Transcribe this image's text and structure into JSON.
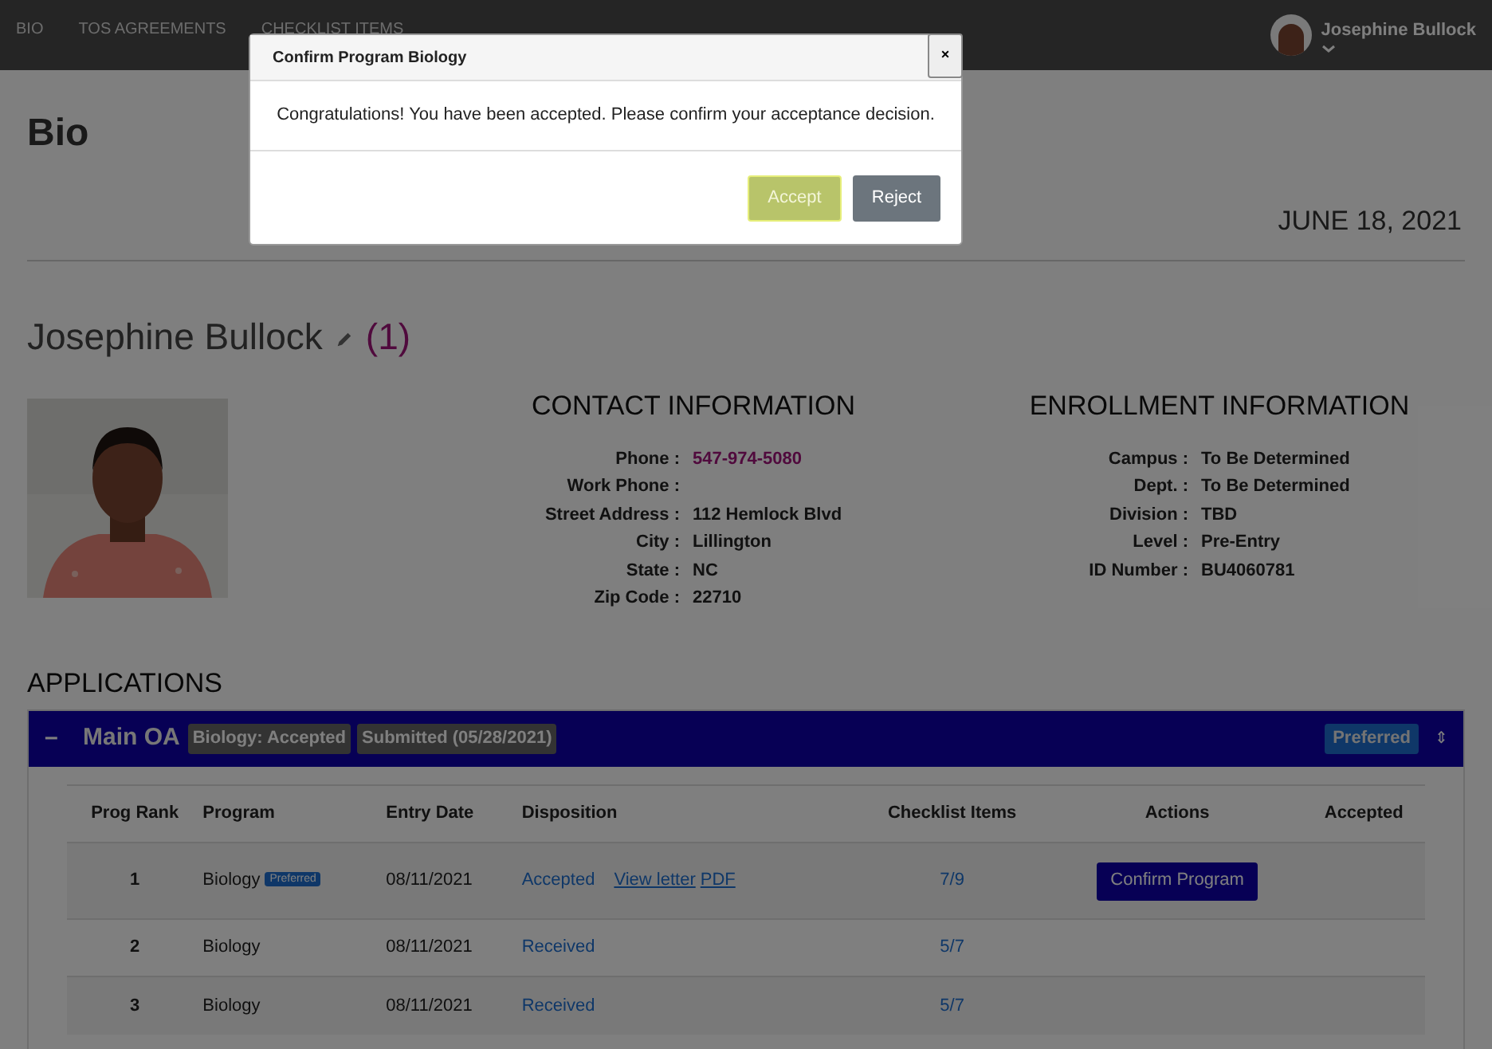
{
  "nav": {
    "items": [
      {
        "label": "BIO"
      },
      {
        "label": "TOS AGREEMENTS"
      },
      {
        "label": "CHECKLIST ITEMS"
      }
    ],
    "user": "Josephine Bullock"
  },
  "page": {
    "title": "Bio",
    "date": "JUNE 18, 2021",
    "name": "Josephine Bullock",
    "count": "(1)"
  },
  "contact": {
    "title": "CONTACT INFORMATION",
    "fields": [
      {
        "label": "Phone :",
        "value": "547-974-5080",
        "kind": "link"
      },
      {
        "label": "Work Phone :"
      },
      {
        "label": "Street Address :",
        "value": "112 Hemlock Blvd",
        "kind": "text"
      },
      {
        "label": "City :",
        "value": "Lillington",
        "kind": "text"
      },
      {
        "label": "State :",
        "value": "NC",
        "kind": "text"
      },
      {
        "label": "Zip Code :",
        "value": "22710",
        "kind": "text"
      }
    ]
  },
  "enrollment": {
    "title": "ENROLLMENT INFORMATION",
    "fields": [
      {
        "label": "Campus :",
        "value": "To Be Determined"
      },
      {
        "label": "Dept. :",
        "value": "To Be Determined"
      },
      {
        "label": "Division :",
        "value": "TBD"
      },
      {
        "label": "Level :",
        "value": "Pre-Entry"
      },
      {
        "label": "ID Number :",
        "value": "BU4060781"
      }
    ]
  },
  "applications": {
    "title": "APPLICATIONS",
    "panel": {
      "toggle": "–",
      "name": "Main OA",
      "badges": [
        "Biology: Accepted",
        "Submitted (05/28/2021)"
      ],
      "preferred": "Preferred",
      "sort": "⇕",
      "expanded": true
    },
    "table": {
      "columns": [
        "Prog Rank",
        "Program",
        "Entry Date",
        "Disposition",
        "Checklist Items",
        "Actions",
        "Accepted"
      ],
      "rows": [
        {
          "rank": "1",
          "program": "Biology",
          "badge": "Preferred",
          "entry": "08/11/2021",
          "disposition": "Accepted",
          "links": [
            "View letter",
            "PDF"
          ],
          "checklist": "7/9",
          "action": "Confirm Program"
        },
        {
          "rank": "2",
          "program": "Biology",
          "entry": "08/11/2021",
          "disposition": "Received",
          "checklist": "5/7"
        },
        {
          "rank": "3",
          "program": "Biology",
          "entry": "08/11/2021",
          "disposition": "Received",
          "checklist": "5/7"
        }
      ]
    }
  },
  "dialog": {
    "title": "Confirm Program Biology",
    "close": "×",
    "message": "Congratulations! You have been accepted. Please confirm your acceptance decision.",
    "buttons": [
      {
        "label": "Accept",
        "kind": "accept"
      },
      {
        "label": "Reject",
        "kind": "reject"
      }
    ]
  }
}
